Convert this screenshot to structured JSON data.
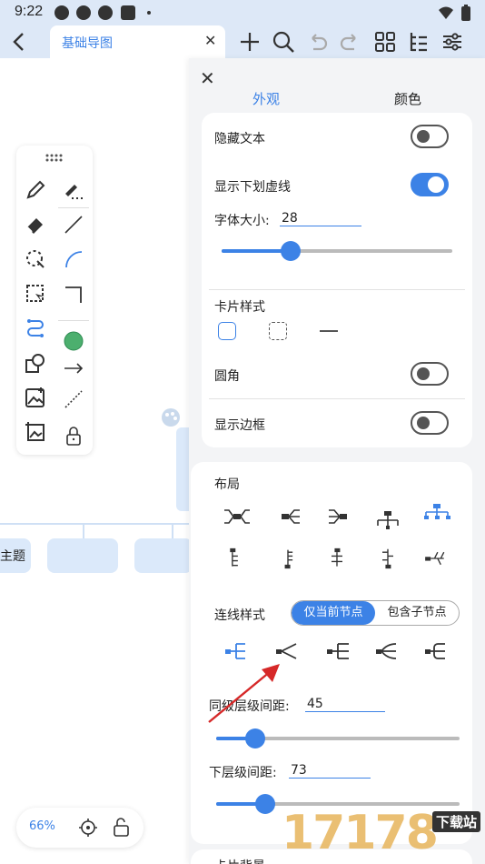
{
  "status": {
    "time": "9:22"
  },
  "tab": {
    "title": "基础导图",
    "close": "✕"
  },
  "canvas": {
    "root_node": "主题",
    "zoom": "66%"
  },
  "panel": {
    "close": "✕",
    "tabs": [
      "外观",
      "颜色"
    ],
    "hide_text_label": "隐藏文本",
    "hide_text_on": false,
    "show_underline_label": "显示下划虚线",
    "show_underline_on": true,
    "font_size_label": "字体大小:",
    "font_size_value": "28",
    "font_size_fraction": 0.3,
    "card_style_label": "卡片样式",
    "rounded_label": "圆角",
    "rounded_on": false,
    "show_border_label": "显示边框",
    "show_border_on": false,
    "layout_label": "布局",
    "line_style_label": "连线样式",
    "line_scope": [
      "仅当前节点",
      "包含子节点"
    ],
    "sibling_gap_label": "同级层级间距:",
    "sibling_gap_value": "45",
    "sibling_gap_fraction": 0.16,
    "child_gap_label": "下层级间距:",
    "child_gap_value": "73",
    "child_gap_fraction": 0.2,
    "card_bg_label": "卡片背景"
  },
  "watermark": {
    "digits": "17178",
    "tag": "下载站"
  },
  "colors": {
    "accent": "#3c82e6",
    "toolbar_bg": "#dde8f7",
    "node_fill": "#dbe9fa",
    "arrow": "#d62828"
  }
}
